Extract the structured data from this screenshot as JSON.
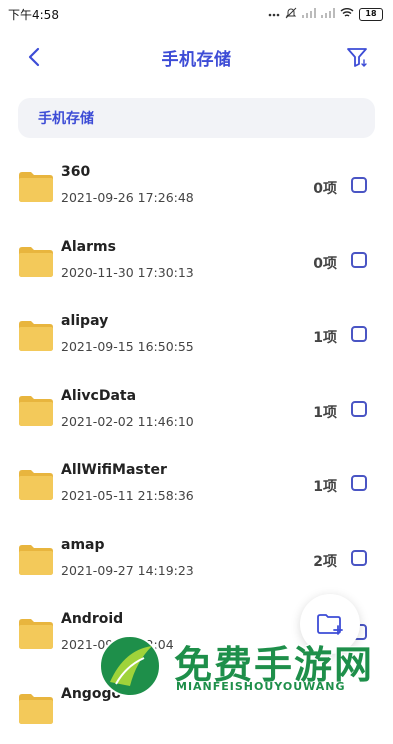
{
  "status_bar": {
    "time": "下午4:58",
    "battery": "18"
  },
  "header": {
    "title": "手机存储",
    "back_icon": "chevron-left-icon",
    "filter_icon": "filter-icon"
  },
  "breadcrumb": {
    "path": "手机存储"
  },
  "files": [
    {
      "name": "360",
      "date": "2021-09-26 17:26:48",
      "count": "0项"
    },
    {
      "name": "Alarms",
      "date": "2020-11-30 17:30:13",
      "count": "0项"
    },
    {
      "name": "alipay",
      "date": "2021-09-15 16:50:55",
      "count": "1项"
    },
    {
      "name": "AlivcData",
      "date": "2021-02-02 11:46:10",
      "count": "1项"
    },
    {
      "name": "AllWifiMaster",
      "date": "2021-05-11 21:58:36",
      "count": "1项"
    },
    {
      "name": "amap",
      "date": "2021-09-27 14:19:23",
      "count": "2项"
    },
    {
      "name": "Android",
      "date": "2021-09-27 12:04",
      "count": ""
    },
    {
      "name": "Angogo",
      "date": "",
      "count": ""
    }
  ],
  "colors": {
    "accent": "#3d4cd6",
    "folder": "#f3c95a",
    "checkbox": "#4a55c4",
    "watermark": "#1e8f4a"
  },
  "watermark": {
    "title": "免费手游网",
    "subtitle": "MIANFEISHOUYOUWANG"
  }
}
